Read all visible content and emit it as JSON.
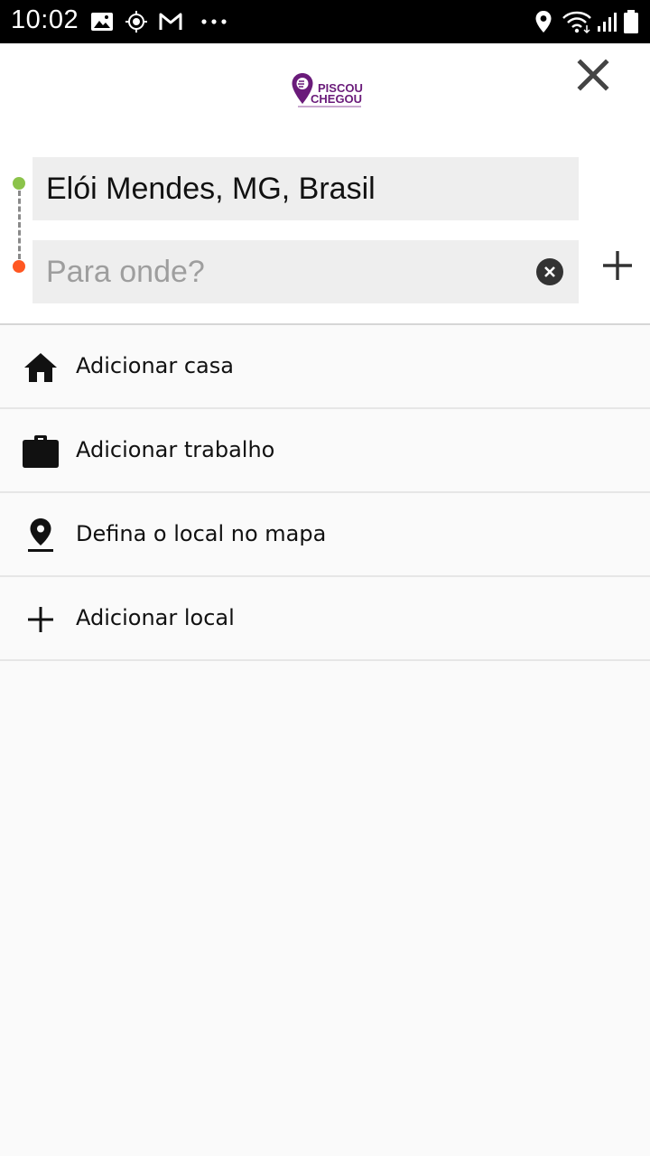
{
  "status_bar": {
    "time": "10:02",
    "left_icons": [
      "image-icon",
      "location-target-icon",
      "gmail-icon",
      "more-dots-icon"
    ],
    "right_icons": [
      "location-pin-icon",
      "wifi-icon",
      "signal-icon",
      "battery-icon"
    ]
  },
  "header": {
    "logo": {
      "line1": "PISCOU",
      "line2": "CHEGOU"
    },
    "close_icon": "close-icon"
  },
  "route": {
    "origin_value": "Elói Mendes, MG, Brasil",
    "destination_placeholder": "Para onde?",
    "destination_value": "",
    "origin_color": "#8bc34a",
    "destination_color": "#ff5722"
  },
  "shortcuts": [
    {
      "icon": "home-icon",
      "label": "Adicionar casa"
    },
    {
      "icon": "briefcase-icon",
      "label": "Adicionar trabalho"
    },
    {
      "icon": "map-pin-icon",
      "label": "Defina o local no mapa"
    },
    {
      "icon": "plus-icon",
      "label": "Adicionar local"
    }
  ],
  "colors": {
    "brand": "#6a1b7a",
    "field_bg": "#eeeeee",
    "background": "#fafafa"
  }
}
